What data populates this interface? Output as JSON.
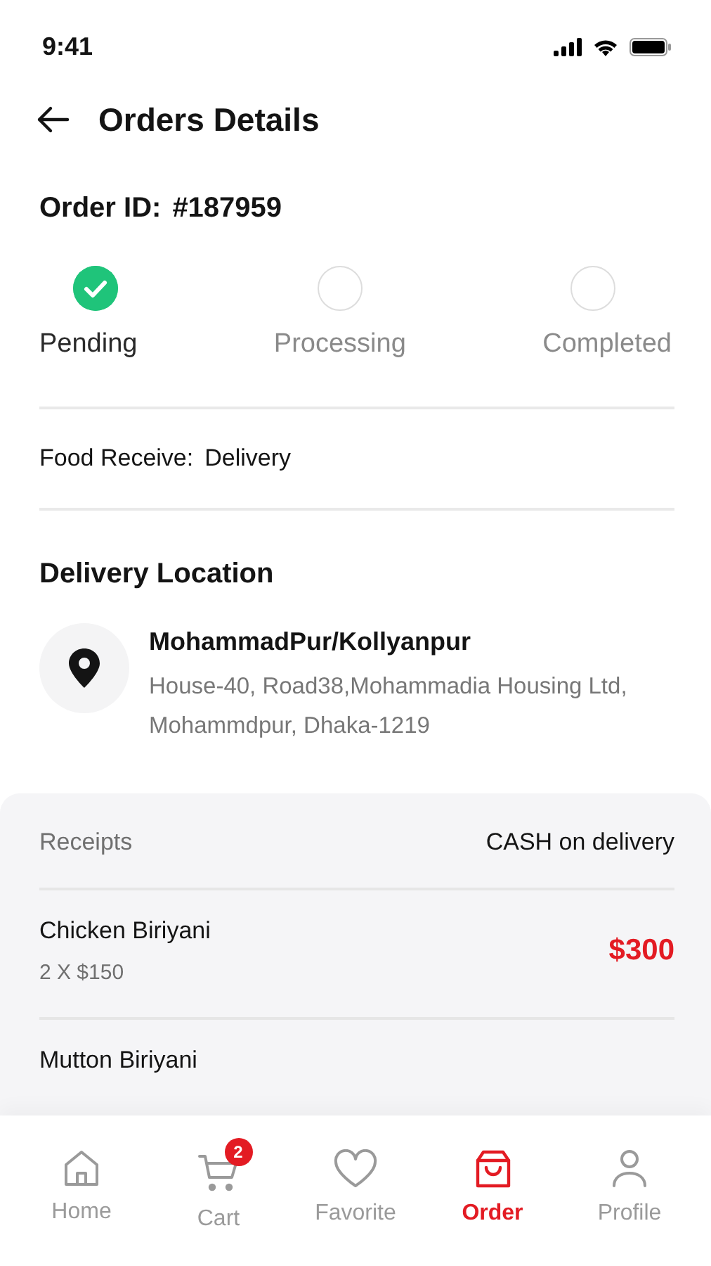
{
  "status_bar": {
    "time": "9:41"
  },
  "header": {
    "title": "Orders Details"
  },
  "order": {
    "label": "Order ID:",
    "id": "#187959"
  },
  "steps": [
    {
      "label": "Pending",
      "done": true
    },
    {
      "label": "Processing",
      "done": false
    },
    {
      "label": "Completed",
      "done": false
    }
  ],
  "food_receive": {
    "label": "Food Receive:",
    "value": "Delivery"
  },
  "delivery_location": {
    "title": "Delivery Location",
    "name": "MohammadPur/Kollyanpur",
    "address": "House-40, Road38,Mohammadia Housing Ltd, Mohammdpur, Dhaka-1219"
  },
  "receipts": {
    "label": "Receipts",
    "payment": "CASH on delivery",
    "items": [
      {
        "name": "Chicken Biriyani",
        "quantity": "2 X $150",
        "price": "$300"
      },
      {
        "name": "Mutton Biriyani"
      }
    ]
  },
  "tab_bar": [
    {
      "kind": "home",
      "label": "Home",
      "selected": false
    },
    {
      "kind": "cart",
      "label": "Cart",
      "selected": false,
      "badge": "2"
    },
    {
      "kind": "favorite",
      "label": "Favorite",
      "selected": false
    },
    {
      "kind": "order",
      "label": "Order",
      "selected": true
    },
    {
      "kind": "profile",
      "label": "Profile",
      "selected": false
    }
  ]
}
